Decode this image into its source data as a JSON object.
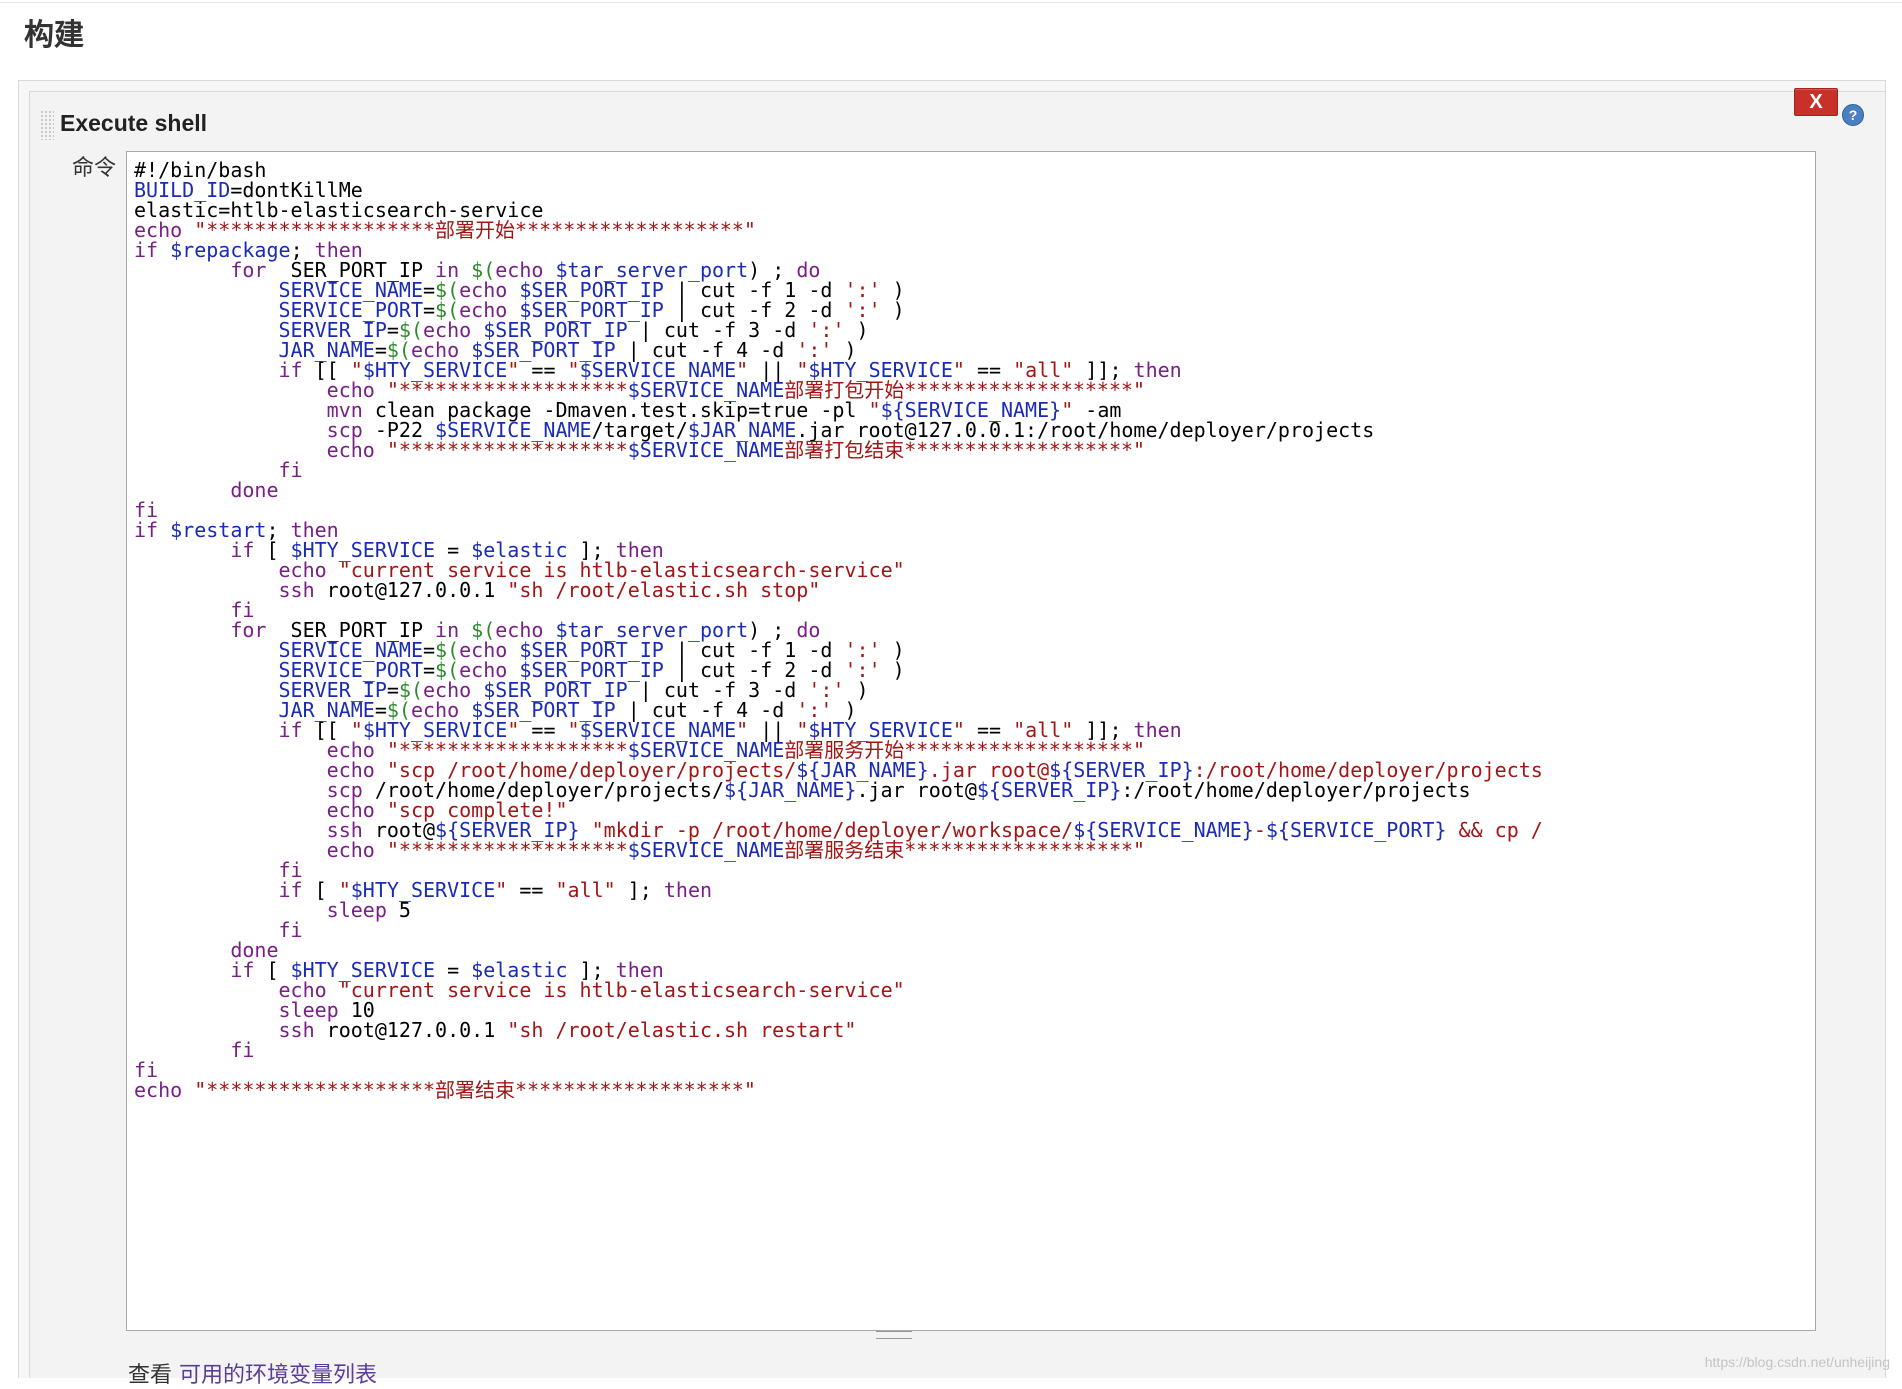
{
  "section": {
    "title": "构建"
  },
  "step": {
    "title": "Execute shell",
    "delete_label": "X",
    "help_label": "?"
  },
  "command": {
    "label": "命令",
    "lines": [
      "#!/bin/bash",
      "BUILD_ID=dontKillMe",
      "elastic=htlb-elasticsearch-service",
      "echo \"*******************部署开始*******************\"",
      "if $repackage; then",
      "        for  SER_PORT_IP in $(echo $tar_server_port) ; do",
      "            SERVICE_NAME=$(echo $SER_PORT_IP | cut -f 1 -d ':' )",
      "            SERVICE_PORT=$(echo $SER_PORT_IP | cut -f 2 -d ':' )",
      "            SERVER_IP=$(echo $SER_PORT_IP | cut -f 3 -d ':' )",
      "            JAR_NAME=$(echo $SER_PORT_IP | cut -f 4 -d ':' )",
      "            if [[ \"$HTY_SERVICE\" == \"$SERVICE_NAME\" || \"$HTY_SERVICE\" == \"all\" ]]; then",
      "                echo \"*******************$SERVICE_NAME部署打包开始*******************\"",
      "                mvn clean package -Dmaven.test.skip=true -pl \"${SERVICE_NAME}\" -am",
      "                scp -P22 $SERVICE_NAME/target/$JAR_NAME.jar root@127.0.0.1:/root/home/deployer/projects",
      "                echo \"*******************$SERVICE_NAME部署打包结束*******************\"",
      "            fi",
      "        done",
      "fi",
      "if $restart; then",
      "        if [ $HTY_SERVICE = $elastic ]; then",
      "            echo \"current service is htlb-elasticsearch-service\"",
      "            ssh root@127.0.0.1 \"sh /root/elastic.sh stop\"",
      "        fi",
      "        for  SER_PORT_IP in $(echo $tar_server_port) ; do",
      "            SERVICE_NAME=$(echo $SER_PORT_IP | cut -f 1 -d ':' )",
      "            SERVICE_PORT=$(echo $SER_PORT_IP | cut -f 2 -d ':' )",
      "            SERVER_IP=$(echo $SER_PORT_IP | cut -f 3 -d ':' )",
      "            JAR_NAME=$(echo $SER_PORT_IP | cut -f 4 -d ':' )",
      "            if [[ \"$HTY_SERVICE\" == \"$SERVICE_NAME\" || \"$HTY_SERVICE\" == \"all\" ]]; then",
      "                echo \"*******************$SERVICE_NAME部署服务开始*******************\"",
      "                echo \"scp /root/home/deployer/projects/${JAR_NAME}.jar root@${SERVER_IP}:/root/home/deployer/projects",
      "                scp /root/home/deployer/projects/${JAR_NAME}.jar root@${SERVER_IP}:/root/home/deployer/projects",
      "                echo \"scp complete!\"",
      "                ssh root@${SERVER_IP} \"mkdir -p /root/home/deployer/workspace/${SERVICE_NAME}-${SERVICE_PORT} && cp /",
      "                echo \"*******************$SERVICE_NAME部署服务结束*******************\"",
      "            fi",
      "            if [ \"$HTY_SERVICE\" == \"all\" ]; then",
      "                sleep 5",
      "            fi",
      "        done",
      "        if [ $HTY_SERVICE = $elastic ]; then",
      "            echo \"current service is htlb-elasticsearch-service\"",
      "            sleep 10",
      "            ssh root@127.0.0.1 \"sh /root/elastic.sh restart\"",
      "        fi",
      "fi",
      "echo \"*******************部署结束*******************\""
    ]
  },
  "env": {
    "prefix": "查看 ",
    "link": "可用的环境变量列表"
  },
  "watermark": "https://blog.csdn.net/unheijing",
  "colors": {
    "delete_button": "#c8302a",
    "help_icon": "#4a7fc2",
    "keyword": "#7a1f87",
    "variable": "#1a2bb5",
    "string": "#a31515",
    "command_sub": "#2e8b2e"
  }
}
